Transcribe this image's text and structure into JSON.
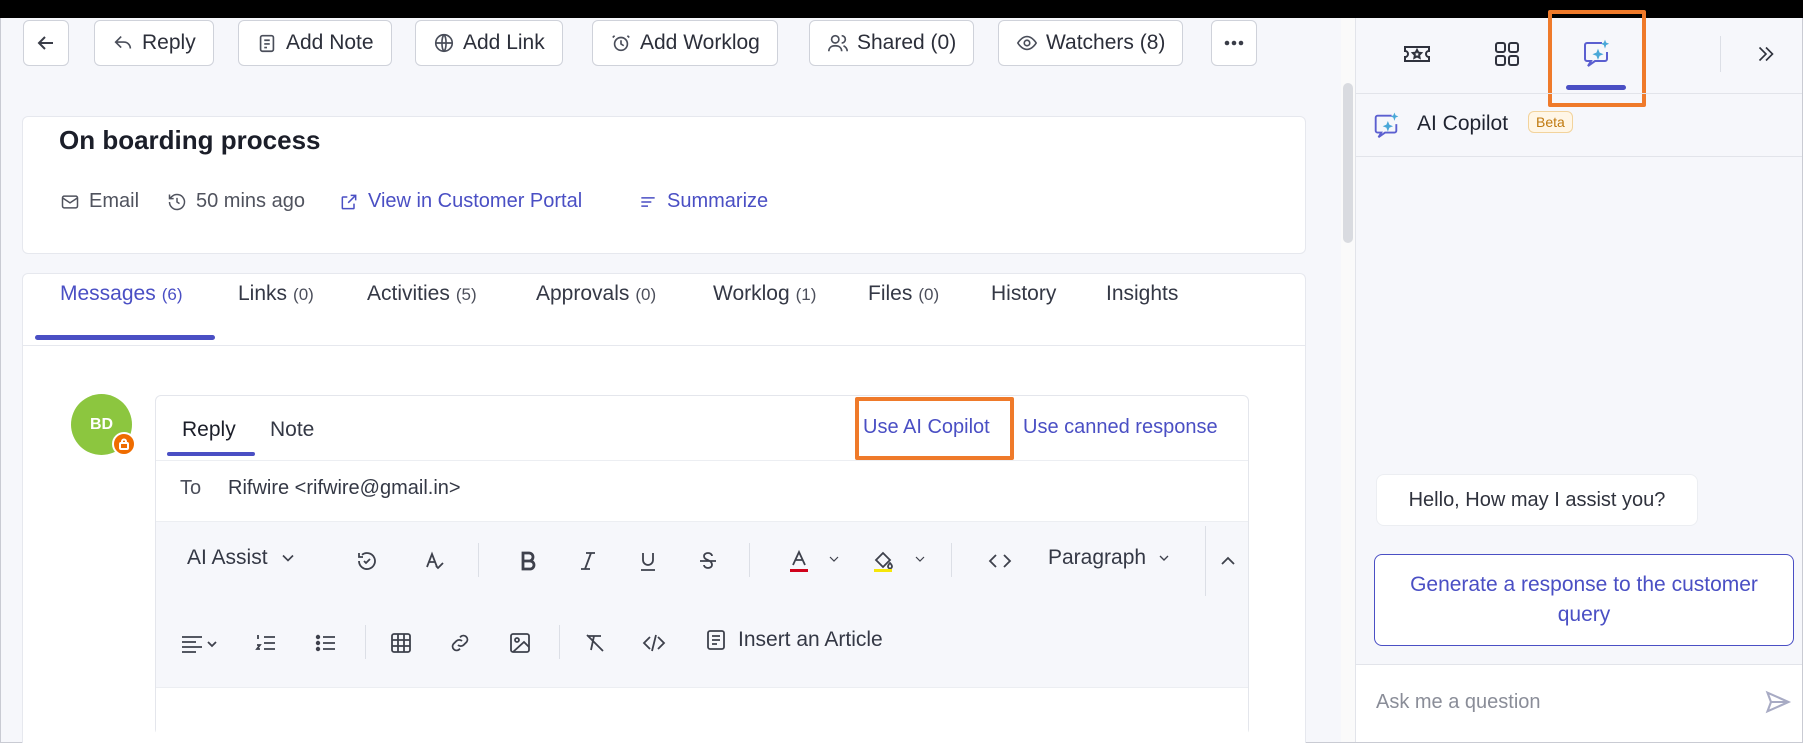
{
  "toolbar": {
    "reply": "Reply",
    "add_note": "Add Note",
    "add_link": "Add Link",
    "add_worklog": "Add Worklog",
    "shared": "Shared (0)",
    "watchers": "Watchers (8)"
  },
  "ticket": {
    "title": "On boarding process",
    "source": "Email",
    "time": "50 mins ago",
    "portal_link": "View in Customer Portal",
    "summarize": "Summarize"
  },
  "tabs": [
    {
      "label": "Messages",
      "count": "(6)"
    },
    {
      "label": "Links",
      "count": "(0)"
    },
    {
      "label": "Activities",
      "count": "(5)"
    },
    {
      "label": "Approvals",
      "count": "(0)"
    },
    {
      "label": "Worklog",
      "count": "(1)"
    },
    {
      "label": "Files",
      "count": "(0)"
    },
    {
      "label": "History",
      "count": ""
    },
    {
      "label": "Insights",
      "count": ""
    }
  ],
  "composer": {
    "avatar_initials": "BD",
    "tab_reply": "Reply",
    "tab_note": "Note",
    "use_ai_copilot": "Use AI Copilot",
    "use_canned": "Use canned response",
    "to_label": "To",
    "to_value": "Rifwire <rifwire@gmail.in>",
    "ai_assist": "AI Assist",
    "paragraph": "Paragraph",
    "insert_article": "Insert an Article"
  },
  "copilot": {
    "title": "AI Copilot",
    "beta": "Beta",
    "greeting": "Hello, How may I assist you?",
    "suggestion": "Generate a response to the customer query",
    "ask_placeholder": "Ask me a question"
  },
  "colors": {
    "accent": "#4a4fc4",
    "highlight": "#ef7a2a",
    "avatar": "#8cc63f",
    "text_color_red": "#d0021b",
    "highlight_yellow": "#f5e60a"
  }
}
